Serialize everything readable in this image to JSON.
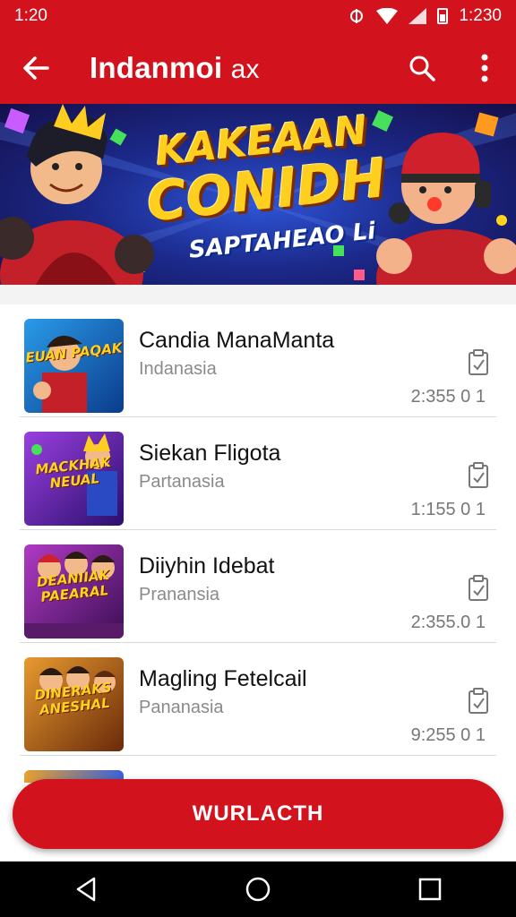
{
  "status_bar": {
    "time": "1:20",
    "clock_right": "1:230"
  },
  "app_bar": {
    "title": "Indanmoi",
    "title_suffix": "ax"
  },
  "banner": {
    "title_line1": "KAKEAAN",
    "title_line2": "CONIDH",
    "subtitle": "SAPTAHEAO Li"
  },
  "games": [
    {
      "title": "Candia ManaManta",
      "subtitle": "Indanasia",
      "count": "2:355 0 1",
      "thumb_text": "EUAN PAQAK",
      "thumb_colors": [
        "#1d8fd9",
        "#0b3c8c"
      ]
    },
    {
      "title": "Siekan Fligota",
      "subtitle": "Partanasia",
      "count": "1:155 0 1",
      "thumb_text": "MACKHAK NEUAL",
      "thumb_colors": [
        "#8a2fc9",
        "#2a0f6b"
      ]
    },
    {
      "title": "Diiyhin Idebat",
      "subtitle": "Pranansia",
      "count": "2:355.0 1",
      "thumb_text": "DEANIIAK PAEARAL",
      "thumb_colors": [
        "#9c2bb7",
        "#3c0f55"
      ]
    },
    {
      "title": "Magling Fetelcail",
      "subtitle": "Pananasia",
      "count": "9:255 0 1",
      "thumb_text": "DINERAKS ANESHAL",
      "thumb_colors": [
        "#e08a1f",
        "#6a2a0a"
      ]
    }
  ],
  "primary_button": {
    "label": "WURLACTH"
  },
  "colors": {
    "accent": "#d2121c",
    "status_icons": "#ffffff"
  },
  "icons": {
    "status": [
      "notification-icon",
      "wifi-icon",
      "signal-icon",
      "battery-icon"
    ],
    "app_bar": [
      "back-arrow-icon",
      "search-icon",
      "more-vert-icon"
    ],
    "list_item": "clipboard-check-icon",
    "nav": [
      "nav-back-icon",
      "nav-home-icon",
      "nav-recents-icon"
    ]
  }
}
